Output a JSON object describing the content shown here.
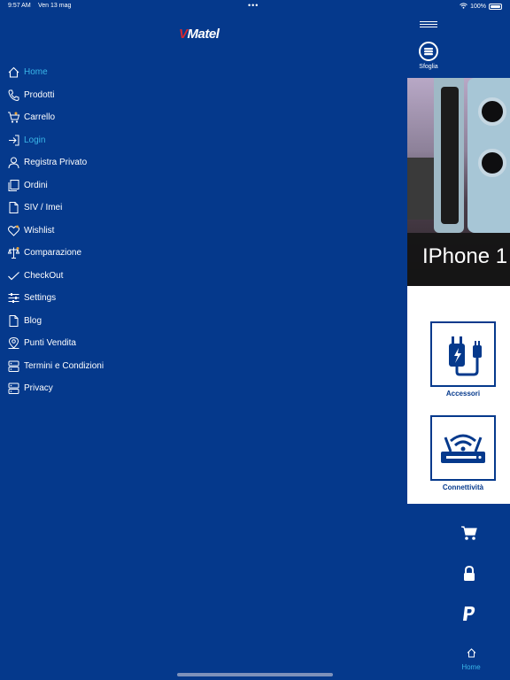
{
  "status_bar": {
    "time": "9:57 AM",
    "date": "Ven 13 mag",
    "dots": "•••",
    "battery": "100%"
  },
  "logo": {
    "prefix": "V",
    "text": "Matel"
  },
  "menu": [
    {
      "label": "Home",
      "icon": "home-icon",
      "active": true
    },
    {
      "label": "Prodotti",
      "icon": "phone-icon",
      "active": false
    },
    {
      "label": "Carrello",
      "icon": "cart-icon",
      "active": false
    },
    {
      "label": "Login",
      "icon": "login-icon",
      "active": true
    },
    {
      "label": "Registra Privato",
      "icon": "user-icon",
      "active": false
    },
    {
      "label": "Ordini",
      "icon": "orders-icon",
      "active": false
    },
    {
      "label": "SIV / Imei",
      "icon": "document-icon",
      "active": false
    },
    {
      "label": "Wishlist",
      "icon": "heart-icon",
      "active": false
    },
    {
      "label": "Comparazione",
      "icon": "compare-icon",
      "active": false
    },
    {
      "label": "CheckOut",
      "icon": "check-icon",
      "active": false
    },
    {
      "label": "Settings",
      "icon": "sliders-icon",
      "active": false
    },
    {
      "label": "Blog",
      "icon": "blog-icon",
      "active": false
    },
    {
      "label": "Punti Vendita",
      "icon": "location-icon",
      "active": false
    },
    {
      "label": "Termini e Condizioni",
      "icon": "terms-icon",
      "active": false
    },
    {
      "label": "Privacy",
      "icon": "privacy-icon",
      "active": false
    }
  ],
  "right_panel": {
    "sfoglia_label": "Sfoglia",
    "hero_title": "IPhone 1",
    "categories": [
      {
        "label": "Accessori",
        "icon": "charger-icon"
      },
      {
        "label": "Connettività",
        "icon": "router-icon"
      }
    ],
    "bottom_home_label": "Home"
  },
  "colors": {
    "background": "#05398c",
    "accent": "#3ab6e8",
    "logo_red": "#d7282f"
  }
}
